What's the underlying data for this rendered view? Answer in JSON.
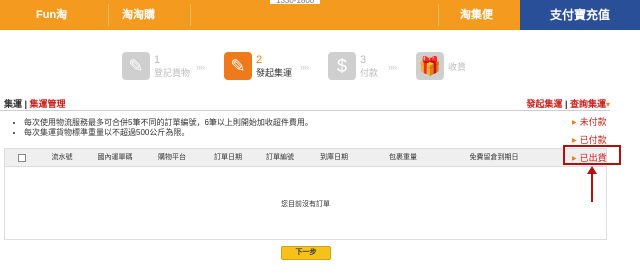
{
  "nav": {
    "logo": "Fun淘",
    "item1": "淘淘購",
    "phone": "1330-1800",
    "item2": "淘集便",
    "pay": "支付寶充值"
  },
  "steps": [
    {
      "num": "1",
      "label": "登記貨物"
    },
    {
      "num": "2",
      "label": "發起集運"
    },
    {
      "num": "3",
      "label": "付款"
    },
    {
      "label": "收貨"
    }
  ],
  "chevron": "»»",
  "section": {
    "title": "集運",
    "sep": " | ",
    "subtitle": "集運管理",
    "link1": "發起集運",
    "link_sep": " | ",
    "link2": "查詢集運",
    "caret": "▾"
  },
  "notes": [
    "每次使用物流服務最多可合併5筆不同的訂單編號，6筆以上則開始加收超件費用。",
    "每次集運貨物標準重量以不超過500公斤為限。"
  ],
  "table": {
    "headers": [
      "流水號",
      "國內運單碼",
      "購物平台",
      "訂單日期",
      "訂單編號",
      "到庫日期",
      "包裹重量",
      "免費留倉到期日"
    ],
    "empty_message": "您目前沒有訂單"
  },
  "status_menu": {
    "items": [
      "未付款",
      "已付款",
      "已出貨"
    ],
    "highlighted": "已出貨"
  },
  "next_button": "下一步",
  "colors": {
    "nav_orange": "#f39a1f",
    "pay_blue": "#2a4f99",
    "accent_red": "#c9211e",
    "annotation_red": "#b01010",
    "button_yellow": "#f5c21b"
  }
}
